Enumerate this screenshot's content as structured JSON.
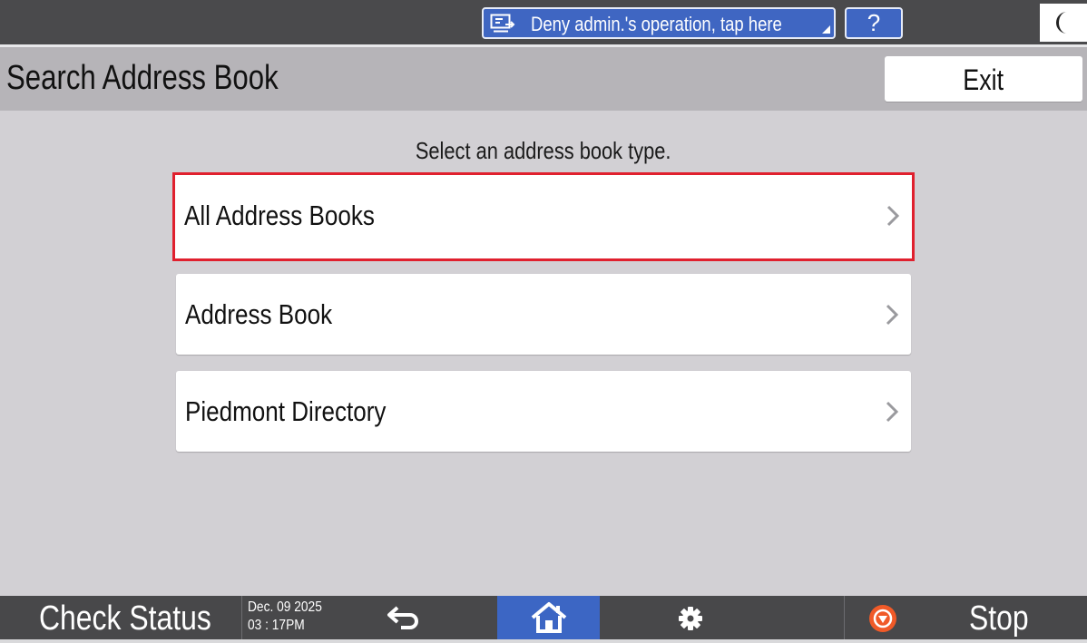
{
  "status_bar": {
    "remote_banner_label": "Deny admin.'s operation, tap here",
    "help_label": "?"
  },
  "header": {
    "title": "Search Address Book",
    "exit_label": "Exit"
  },
  "main": {
    "prompt": "Select an address book type.",
    "options": [
      {
        "label": "All Address Books",
        "selected": true
      },
      {
        "label": "Address Book",
        "selected": false
      },
      {
        "label": "Piedmont Directory",
        "selected": false
      }
    ]
  },
  "bottom_bar": {
    "check_status_label": "Check Status",
    "date": "Dec. 09 2025",
    "time": "03 : 17PM",
    "stop_label": "Stop"
  },
  "icons": {
    "remote": "remote-monitor-icon",
    "energy": "moon-icon",
    "option_arrow": "chevron-right-icon",
    "back": "back-arrow-icon",
    "home": "home-icon",
    "settings": "gear-icon",
    "stop": "stop-icon"
  },
  "colors": {
    "accent_blue": "#3f66c2",
    "selection_red": "#e0202e",
    "stop_orange": "#f05a28",
    "bar_dark": "#4a4a4c",
    "title_gray": "#b6b4b8",
    "main_gray": "#d2d0d4"
  }
}
